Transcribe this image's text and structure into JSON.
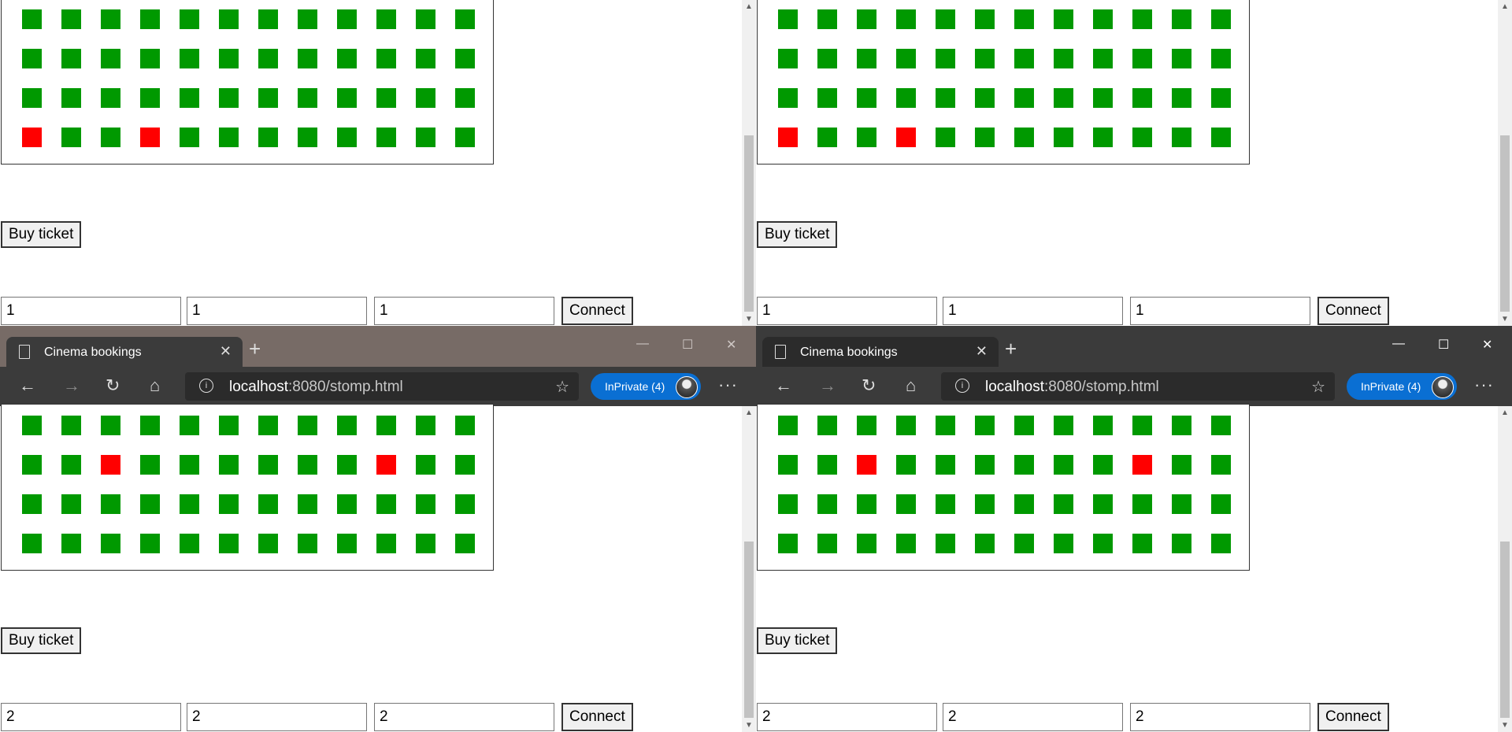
{
  "colors": {
    "seat_free": "#009900",
    "seat_taken": "#ff0000",
    "tabbar_left": "#776b66",
    "tabbar_right": "#3b3b3b",
    "inprivate": "#0a6fd3"
  },
  "windows": [
    {
      "id": "top-left",
      "buy_label": "Buy ticket",
      "fields": [
        "1",
        "1",
        "1"
      ],
      "connect_label": "Connect",
      "taken_seats": [
        [
          3,
          0
        ],
        [
          3,
          3
        ]
      ]
    },
    {
      "id": "top-right",
      "buy_label": "Buy ticket",
      "fields": [
        "1",
        "1",
        "1"
      ],
      "connect_label": "Connect",
      "taken_seats": [
        [
          3,
          0
        ],
        [
          3,
          3
        ]
      ]
    },
    {
      "id": "bottom-left",
      "tab_title": "Cinema bookings",
      "url_host": "localhost",
      "url_rest": ":8080/stomp.html",
      "inprivate_label": "InPrivate (4)",
      "buy_label": "Buy ticket",
      "fields": [
        "2",
        "2",
        "2"
      ],
      "connect_label": "Connect",
      "taken_seats": [
        [
          1,
          2
        ],
        [
          1,
          9
        ]
      ]
    },
    {
      "id": "bottom-right",
      "tab_title": "Cinema bookings",
      "url_host": "localhost",
      "url_rest": ":8080/stomp.html",
      "inprivate_label": "InPrivate (4)",
      "buy_label": "Buy ticket",
      "fields": [
        "2",
        "2",
        "2"
      ],
      "connect_label": "Connect",
      "taken_seats": [
        [
          1,
          2
        ],
        [
          1,
          9
        ]
      ]
    }
  ],
  "seat_grid": {
    "rows": 4,
    "cols": 12
  },
  "icons": [
    "document-icon",
    "close-icon",
    "new-tab-icon",
    "back-icon",
    "forward-icon",
    "refresh-icon",
    "home-icon",
    "info-icon",
    "favorite-star-icon",
    "avatar-icon",
    "more-icon",
    "minimize-icon",
    "maximize-icon",
    "window-close-icon"
  ]
}
